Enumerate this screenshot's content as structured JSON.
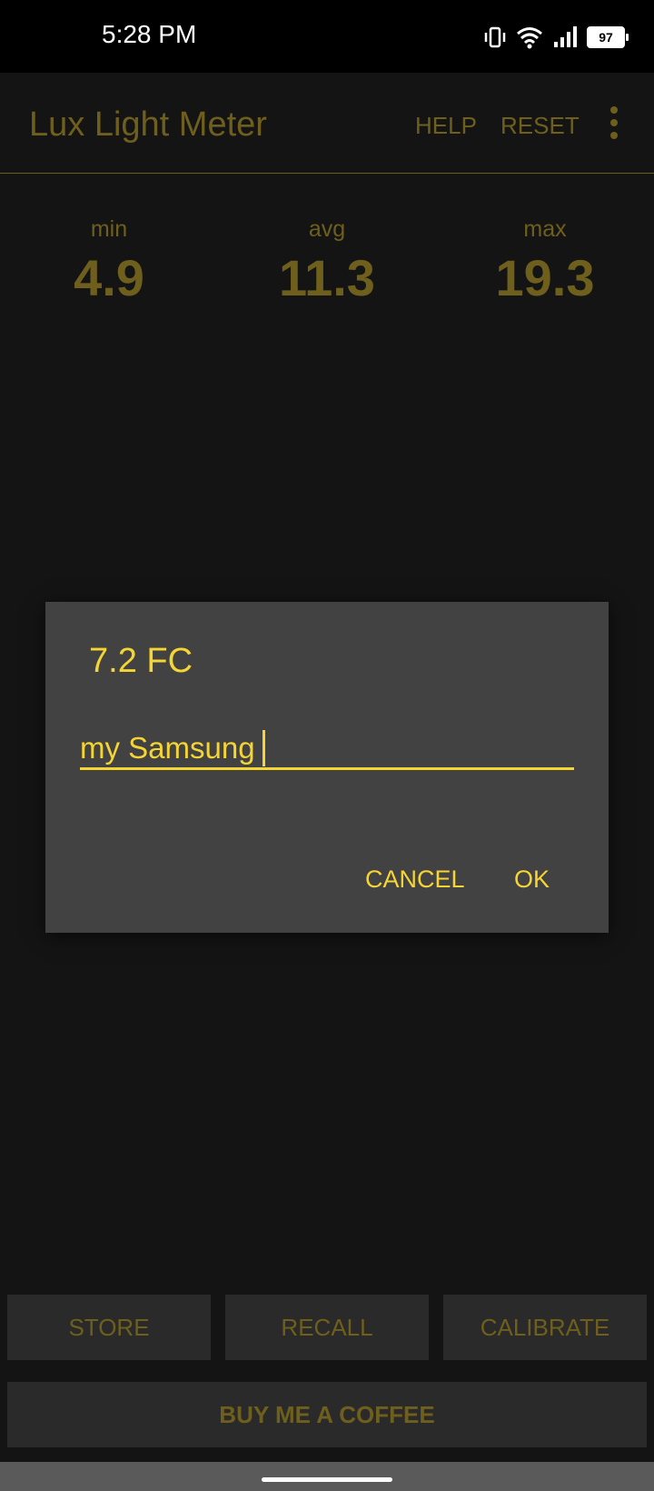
{
  "status": {
    "time": "5:28 PM",
    "battery": "97"
  },
  "app": {
    "title": "Lux Light Meter",
    "actions": {
      "help": "HELP",
      "reset": "RESET"
    }
  },
  "stats": {
    "min": {
      "label": "min",
      "value": "4.9"
    },
    "avg": {
      "label": "avg",
      "value": "11.3"
    },
    "max": {
      "label": "max",
      "value": "19.3"
    }
  },
  "dialog": {
    "title": "7.2 FC",
    "input_value": "my Samsung",
    "cancel": "CANCEL",
    "ok": "OK"
  },
  "buttons": {
    "store": "STORE",
    "recall": "RECALL",
    "calibrate": "CALIBRATE",
    "coffee": "BUY ME A COFFEE"
  },
  "colors": {
    "accent": "#f5d534",
    "dim_accent": "#6e5f1c",
    "background": "#141414",
    "dialog": "#424242"
  }
}
